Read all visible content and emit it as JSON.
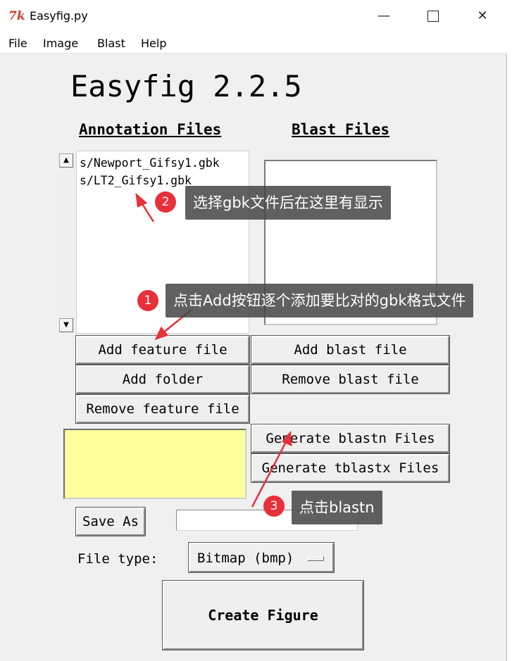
{
  "window": {
    "title": "Easyfig.py",
    "icon_glyph": "7k",
    "controls": {
      "minimize": "—",
      "maximize": "□",
      "close": "✕"
    }
  },
  "menubar": {
    "items": [
      "File",
      "Image",
      "Blast",
      "Help"
    ]
  },
  "app": {
    "title": "Easyfig 2.2.5",
    "annotation_files_header": "Annotation Files",
    "blast_files_header": "Blast Files",
    "annotation_files": [
      "s/Newport_Gifsy1.gbk",
      "s/LT2_Gifsy1.gbk"
    ],
    "blast_files": [],
    "buttons": {
      "add_feature": "Add feature file",
      "add_blast": "Add blast file",
      "add_folder": "Add folder",
      "remove_blast": "Remove blast file",
      "remove_feature": "Remove feature file",
      "generate_blastn": "Generate blastn Files",
      "generate_tblastx": "Generate tblastx Files",
      "save_as": "Save As",
      "create_figure": "Create Figure"
    },
    "save_path_value": "",
    "file_type_label": "File type:",
    "file_type_selected": "Bitmap (bmp)",
    "colors": {
      "swatch": "#ffff9d",
      "window_bg": "#f0f0f0"
    }
  },
  "annotations": {
    "callout_1": {
      "number": "1",
      "text": "点击Add按钮逐个添加要比对的gbk格式文件"
    },
    "callout_2": {
      "number": "2",
      "text": "选择gbk文件后在这里有显示"
    },
    "callout_3": {
      "number": "3",
      "text": "点击blastn"
    },
    "colors": {
      "badge": "#e8303a",
      "arrow": "#e8303a",
      "callout_bg": "#464646"
    }
  }
}
